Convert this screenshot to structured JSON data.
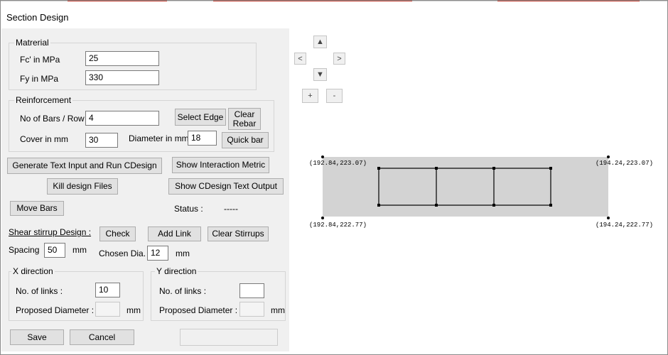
{
  "window": {
    "title": "Section Design"
  },
  "material": {
    "title": "Matrerial",
    "fc_label": "Fc' in MPa",
    "fc_value": "25",
    "fy_label": "Fy in MPa",
    "fy_value": "330"
  },
  "reinforcement": {
    "title": "Reinforcement",
    "bars_label": "No of Bars / Row",
    "bars_value": "4",
    "select_edge_label": "Select Edge",
    "clear_rebar_label_1": "Clear",
    "clear_rebar_label_2": "Rebar",
    "cover_label": "Cover in mm",
    "cover_value": "30",
    "diameter_label": "Diameter in mm",
    "diameter_value": "18",
    "quick_bar_label": "Quick bar"
  },
  "actions": {
    "generate_label": "Generate Text Input and Run CDesign",
    "interaction_label": "Show Interaction Metric",
    "kill_label": "Kill design Files",
    "show_output_label": "Show CDesign Text Output",
    "move_bars_label": "Move Bars"
  },
  "status": {
    "label": "Status :",
    "value": "-----"
  },
  "shear": {
    "title": "Shear stirrup Design :",
    "check_label": "Check",
    "add_link_label": "Add Link",
    "clear_stirrups_label": "Clear Stirrups",
    "spacing_label": "Spacing",
    "spacing_value": "50",
    "spacing_unit": "mm",
    "chosen_dia_label": "Chosen Dia. :",
    "chosen_dia_value": "12",
    "chosen_dia_unit": "mm"
  },
  "x_direction": {
    "title": "X direction",
    "links_label": "No. of links :",
    "links_value": "10",
    "proposed_label": "Proposed Diameter :",
    "proposed_value": "",
    "unit": "mm"
  },
  "y_direction": {
    "title": "Y direction",
    "links_label": "No. of links :",
    "links_value": "",
    "proposed_label": "Proposed Diameter :",
    "proposed_value": "",
    "unit": "mm"
  },
  "footer": {
    "save_label": "Save",
    "cancel_label": "Cancel",
    "extra_label": ""
  },
  "canvas": {
    "nav": {
      "up": "▲",
      "down": "▼",
      "left": "<",
      "right": ">",
      "zoom_in": "+",
      "zoom_out": "-"
    },
    "corner_labels": {
      "top_left": "(192.84,223.07)",
      "top_right": "(194.24,223.07)",
      "bottom_left": "(192.84,222.77)",
      "bottom_right": "(194.24,222.77)"
    },
    "section_fill": "#d3d3d3"
  },
  "colors": {
    "accent_red": "#c0392b",
    "panel_bg": "#f0f0f0",
    "button_bg": "#e1e1e1"
  }
}
